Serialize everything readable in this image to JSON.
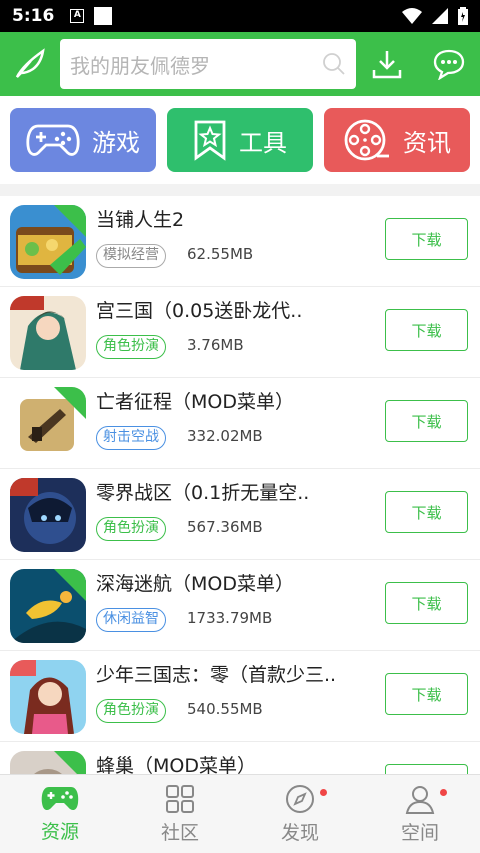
{
  "status": {
    "time": "5:16"
  },
  "search": {
    "placeholder": "我的朋友佩德罗"
  },
  "categories": [
    {
      "label": "游戏",
      "icon": "gamepad-icon",
      "color": "#6c87e0"
    },
    {
      "label": "工具",
      "icon": "bookmark-star-icon",
      "color": "#2fbf6d"
    },
    {
      "label": "资讯",
      "icon": "film-reel-icon",
      "color": "#e85a5a"
    }
  ],
  "download_label": "下载",
  "apps": [
    {
      "name": "当铺人生2",
      "tag": "模拟经营",
      "tag_color": "#888888",
      "size": "62.55MB"
    },
    {
      "name": "宫三国（0.05送卧龙代..",
      "tag": "角色扮演",
      "tag_color": "#3cbf4a",
      "size": "3.76MB"
    },
    {
      "name": "亡者征程（MOD菜单）",
      "tag": "射击空战",
      "tag_color": "#4a90e2",
      "size": "332.02MB"
    },
    {
      "name": "零界战区（0.1折无量空..",
      "tag": "角色扮演",
      "tag_color": "#3cbf4a",
      "size": "567.36MB"
    },
    {
      "name": "深海迷航（MOD菜单）",
      "tag": "休闲益智",
      "tag_color": "#4a90e2",
      "size": "1733.79MB"
    },
    {
      "name": "少年三国志：零（首款少三..",
      "tag": "角色扮演",
      "tag_color": "#3cbf4a",
      "size": "540.55MB"
    },
    {
      "name": "蜂巢（MOD菜单）",
      "tag": "",
      "tag_color": "#888888",
      "size": ""
    }
  ],
  "tabs": [
    {
      "label": "资源",
      "active": true
    },
    {
      "label": "社区",
      "active": false
    },
    {
      "label": "发现",
      "active": false
    },
    {
      "label": "空间",
      "active": false
    }
  ],
  "colors": {
    "brand": "#3cbf4a"
  }
}
